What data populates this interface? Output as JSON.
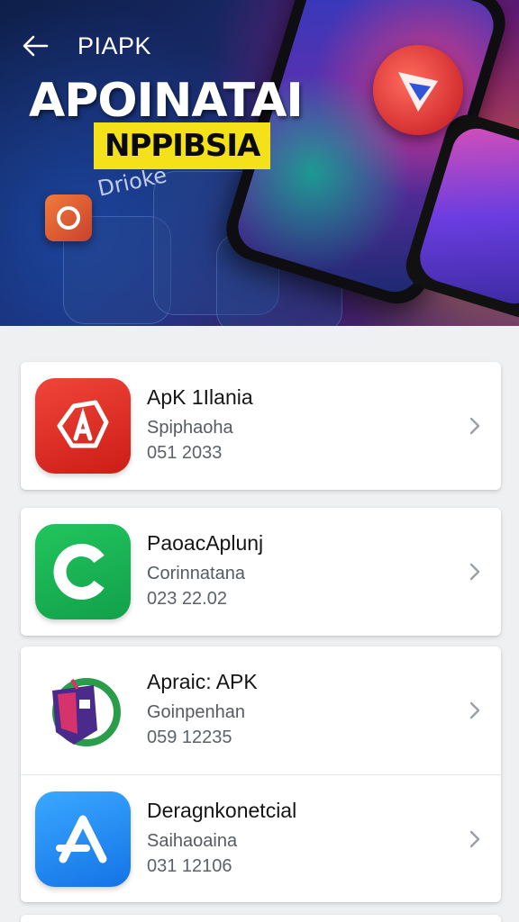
{
  "header": {
    "brand": "PIAPK",
    "headline": "APOINATAI",
    "tag": "NPPIBSIA",
    "side_word": "Drioke"
  },
  "apps": [
    {
      "name": "ApK 1Ilania",
      "category": "Spiphaoha",
      "version": "051 2033",
      "icon": "red-a-icon",
      "color": "#e02a1f"
    },
    {
      "name": "PaoacAplunj",
      "category": "Corinnatana",
      "version": "023 22.02",
      "icon": "green-c-icon",
      "color": "#1db954"
    },
    {
      "name": "Apraic: APK",
      "category": "Goinpenhan",
      "version": "059 12235",
      "icon": "colorful-robot-icon",
      "color": "#2a9d4a"
    },
    {
      "name": "Deragnkonetcial",
      "category": "Saihaoaina",
      "version": "031 12106",
      "icon": "blue-a-icon",
      "color": "#1e8ef0"
    }
  ],
  "colors": {
    "background": "#eef0f2",
    "card": "#ffffff",
    "tag_yellow": "#f4e11a"
  }
}
